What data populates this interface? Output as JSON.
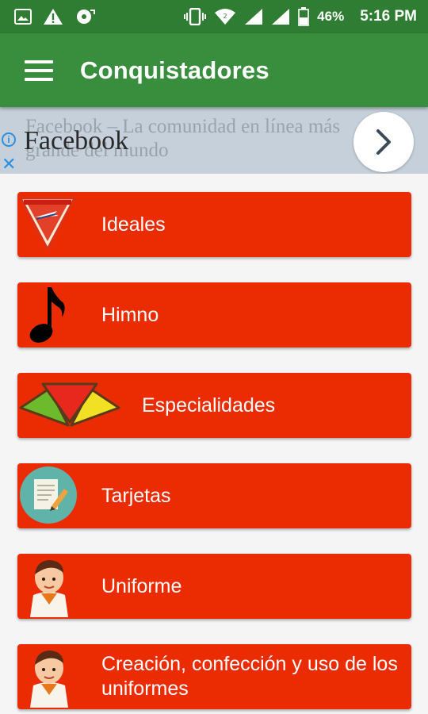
{
  "status_bar": {
    "battery": "46%",
    "time": "5:16 PM"
  },
  "app_bar": {
    "title": "Conquistadores"
  },
  "ad": {
    "bg_text": "Facebook – La comunidad en línea más grande del mundo",
    "title": "Facebook",
    "info_glyph": "i",
    "close_glyph": "✕"
  },
  "menu": {
    "items": [
      {
        "label": "Ideales",
        "icon": "pathfinder-emblem-icon"
      },
      {
        "label": "Himno",
        "icon": "music-note-icon"
      },
      {
        "label": "Especialidades",
        "icon": "specialty-triangles-icon"
      },
      {
        "label": "Tarjetas",
        "icon": "notepad-pencil-icon"
      },
      {
        "label": "Uniforme",
        "icon": "pathfinder-boy-icon"
      },
      {
        "label": "Creación, confección y uso de los uniformes",
        "icon": "pathfinder-boy-icon"
      }
    ]
  },
  "colors": {
    "status_bar": "#2f7d32",
    "app_bar": "#388e3c",
    "item_bg": "#eb2c03",
    "ad_bg": "#c5d0da",
    "page_bg": "#f5f5f5"
  }
}
